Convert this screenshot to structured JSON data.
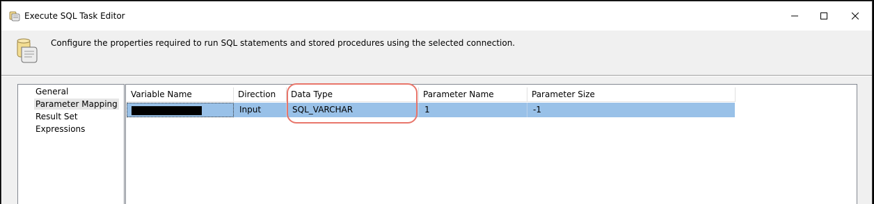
{
  "window": {
    "title": "Execute SQL Task Editor",
    "minimize_glyph": "—",
    "maximize_glyph": "☐",
    "close_glyph": "✕"
  },
  "header": {
    "description": "Configure the properties required to run SQL statements and stored procedures using the selected connection."
  },
  "nav": {
    "items": [
      {
        "label": "General",
        "selected": false
      },
      {
        "label": "Parameter Mapping",
        "selected": true
      },
      {
        "label": "Result Set",
        "selected": false
      },
      {
        "label": "Expressions",
        "selected": false
      }
    ]
  },
  "grid": {
    "columns": [
      "Variable Name",
      "Direction",
      "Data Type",
      "Parameter Name",
      "Parameter Size"
    ],
    "rows": [
      {
        "variable_name": "",
        "direction": "Input",
        "data_type": "SQL_VARCHAR",
        "parameter_name": "1",
        "parameter_size": "-1"
      }
    ]
  },
  "icons": [
    "scroll-app-icon",
    "minimize-icon",
    "maximize-icon",
    "close-icon",
    "scroll-header-icon"
  ],
  "colors": {
    "selected_row": "#99c1e8",
    "annotation_circle": "#e8756a",
    "redaction": "#000000"
  }
}
